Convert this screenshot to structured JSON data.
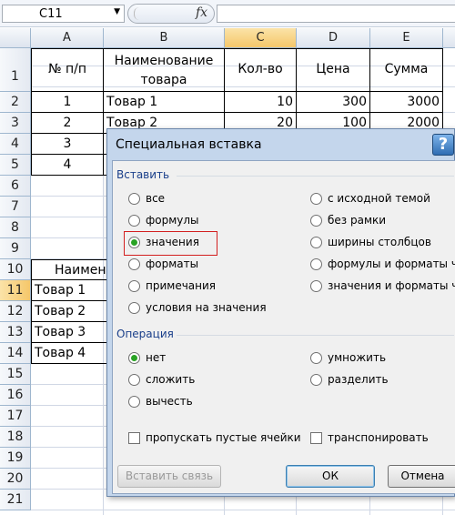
{
  "formula_bar": {
    "name_box": "C11",
    "fx_label": "fx"
  },
  "sheet": {
    "columns": [
      "A",
      "B",
      "C",
      "D",
      "E"
    ],
    "rows": [
      "1",
      "2",
      "3",
      "4",
      "5",
      "6",
      "7",
      "8",
      "9",
      "10",
      "11",
      "12",
      "13",
      "14",
      "15",
      "16",
      "17",
      "18",
      "19",
      "20",
      "21"
    ],
    "table1": {
      "headers": [
        "№ п/п",
        "Наименование товара",
        "Кол-во",
        "Цена",
        "Сумма"
      ],
      "rows": [
        [
          "1",
          "Товар 1",
          "10",
          "300",
          "3000"
        ],
        [
          "2",
          "Товар 2",
          "20",
          "100",
          "2000"
        ],
        [
          "3",
          "",
          "",
          "",
          ""
        ],
        [
          "4",
          "",
          "",
          "",
          ""
        ]
      ]
    },
    "table2": {
      "header": "Наимен",
      "items": [
        "Товар 1",
        "Товар 2",
        "Товар 3",
        "Товар 4"
      ]
    }
  },
  "dialog": {
    "title": "Специальная вставка",
    "help_label": "?",
    "paste_group": {
      "label": "Вставить",
      "left": [
        "все",
        "формулы",
        "значения",
        "форматы",
        "примечания",
        "условия на значения"
      ],
      "right": [
        "с исходной темой",
        "без рамки",
        "ширины столбцов",
        "формулы и форматы чи",
        "значения и форматы чи"
      ],
      "selected": "значения"
    },
    "operation_group": {
      "label": "Операция",
      "left": [
        "нет",
        "сложить",
        "вычесть"
      ],
      "right": [
        "умножить",
        "разделить"
      ],
      "selected": "нет"
    },
    "checkboxes": [
      "пропускать пустые ячейки",
      "транспонировать"
    ],
    "buttons": {
      "paste_link": "Вставить связь",
      "ok": "ОК",
      "cancel": "Отмена"
    }
  },
  "colors": {
    "active_header": "#f5c76a",
    "dialog_frame": "#c4d6ec",
    "radio_selected": "#29a324",
    "highlight_box": "#d31f1f"
  }
}
